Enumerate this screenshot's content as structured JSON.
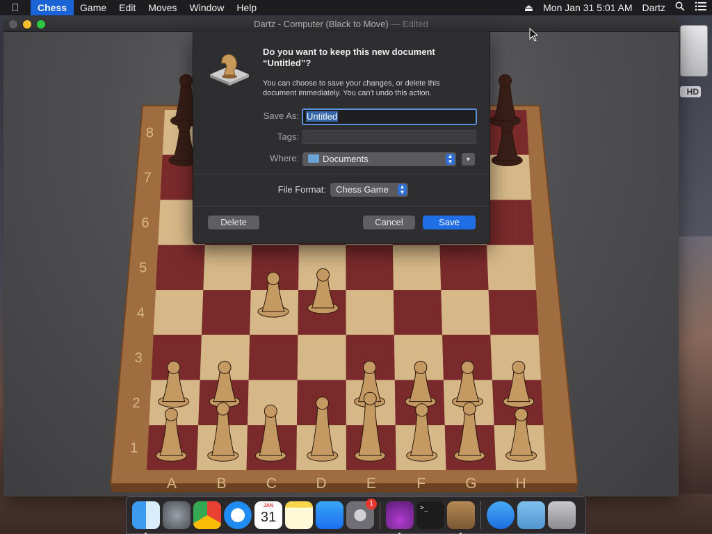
{
  "menubar": {
    "apple_icon": "apple-icon",
    "app_name": "Chess",
    "menus": [
      "Game",
      "Edit",
      "Moves",
      "Window",
      "Help"
    ],
    "datetime": "Mon Jan 31  5:01 AM",
    "user": "Dartz",
    "status_icons": [
      "eject-icon",
      "spotlight-search-icon",
      "notification-center-icon"
    ]
  },
  "desktop": {
    "disk_label": "HD"
  },
  "window": {
    "title": "Dartz - Computer   (Black to Move)",
    "title_suffix": "— Edited"
  },
  "board": {
    "ranks": [
      "8",
      "7",
      "6",
      "5",
      "4",
      "3",
      "2",
      "1"
    ],
    "files": [
      "A",
      "B",
      "C",
      "D",
      "E",
      "F",
      "G",
      "H"
    ],
    "colors": {
      "dark": "#7a2a2a",
      "light": "#d6b888",
      "frame": "#9a6a3c",
      "white_piece": "#c49a62",
      "black_piece": "#3a1e18"
    }
  },
  "dialog": {
    "heading": "Do you want to keep this new document “Untitled”?",
    "message": "You can choose to save your changes, or delete this document immediately. You can't undo this action.",
    "save_as_label": "Save As:",
    "save_as_value": "Untitled",
    "tags_label": "Tags:",
    "tags_value": "",
    "where_label": "Where:",
    "where_value": "Documents",
    "file_format_label": "File Format:",
    "file_format_value": "Chess Game",
    "delete_label": "Delete",
    "cancel_label": "Cancel",
    "save_label": "Save",
    "accent": "#1f6ee6"
  },
  "dock": {
    "items": [
      {
        "name": "finder-icon",
        "running": true
      },
      {
        "name": "launchpad-icon",
        "running": false
      },
      {
        "name": "chrome-icon",
        "running": false
      },
      {
        "name": "safari-icon",
        "running": false
      },
      {
        "name": "calendar-icon",
        "running": false,
        "month": "JAN",
        "day": "31"
      },
      {
        "name": "notes-icon",
        "running": false
      },
      {
        "name": "app-store-icon",
        "running": false
      },
      {
        "name": "system-preferences-icon",
        "running": false,
        "badge": "1"
      },
      {
        "name": "installer-icon",
        "running": true
      },
      {
        "name": "terminal-icon",
        "running": false
      },
      {
        "name": "chess-icon",
        "running": true
      },
      {
        "name": "applications-folder-icon",
        "running": false
      },
      {
        "name": "downloads-folder-icon",
        "running": false
      },
      {
        "name": "trash-icon",
        "running": false
      }
    ]
  }
}
